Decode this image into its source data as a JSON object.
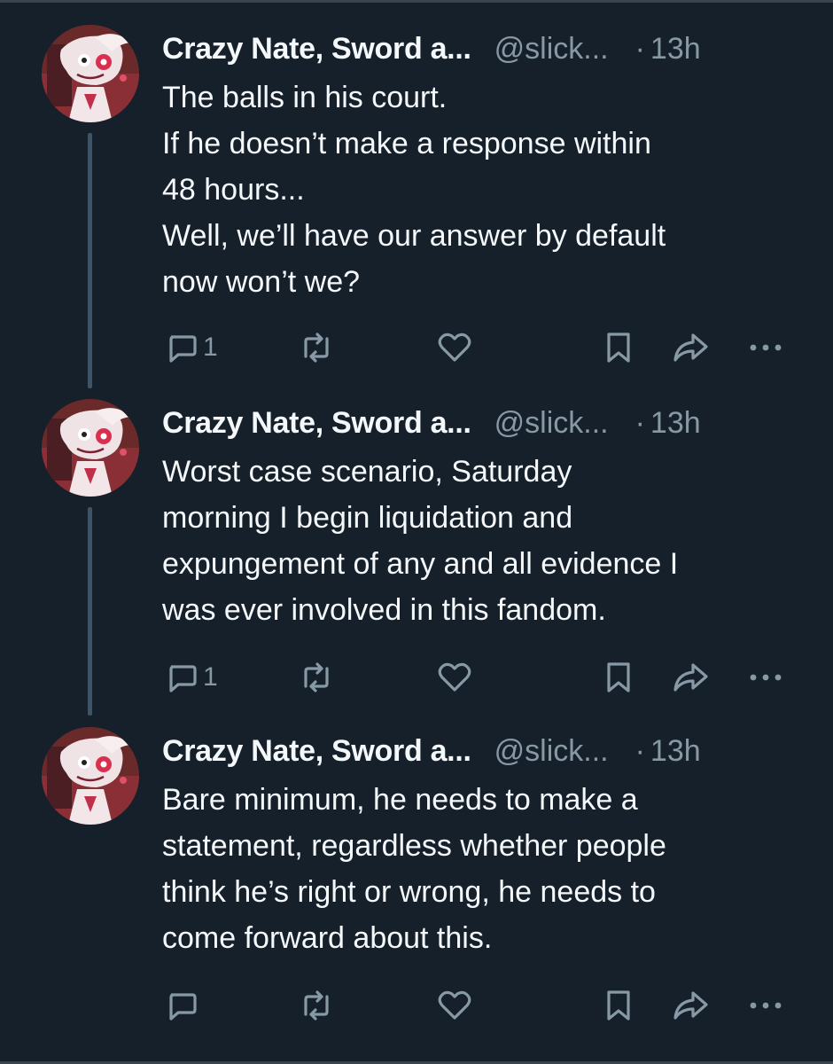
{
  "tweets": [
    {
      "name": "Crazy Nate, Sword a...",
      "handle": "@slick...",
      "dot": "·",
      "time": "13h",
      "lines": [
        "The balls in his court.",
        "If he doesn’t make a response within",
        "48 hours...",
        "Well, we’ll have our answer by default",
        "now won’t we?"
      ],
      "reply_count": "1"
    },
    {
      "name": "Crazy Nate, Sword a...",
      "handle": "@slick...",
      "dot": "·",
      "time": "13h",
      "lines": [
        "Worst case scenario, Saturday",
        "morning I begin liquidation and",
        "expungement of any and all evidence I",
        "was ever involved in this fandom."
      ],
      "reply_count": "1"
    },
    {
      "name": "Crazy Nate, Sword a...",
      "handle": "@slick...",
      "dot": "·",
      "time": "13h",
      "lines": [
        "Bare minimum, he needs to make a",
        "statement, regardless whether people",
        "think he’s right or wrong, he needs to",
        "come forward about this."
      ],
      "reply_count": ""
    }
  ],
  "icons": {
    "reply": "reply-icon",
    "retweet": "retweet-icon",
    "like": "heart-icon",
    "bookmark": "bookmark-icon",
    "share": "share-icon",
    "more": "more-icon"
  },
  "colors": {
    "background": "#15202b",
    "text": "#f5f8fa",
    "secondary": "#8899a6",
    "thread_line": "#3d5466"
  }
}
